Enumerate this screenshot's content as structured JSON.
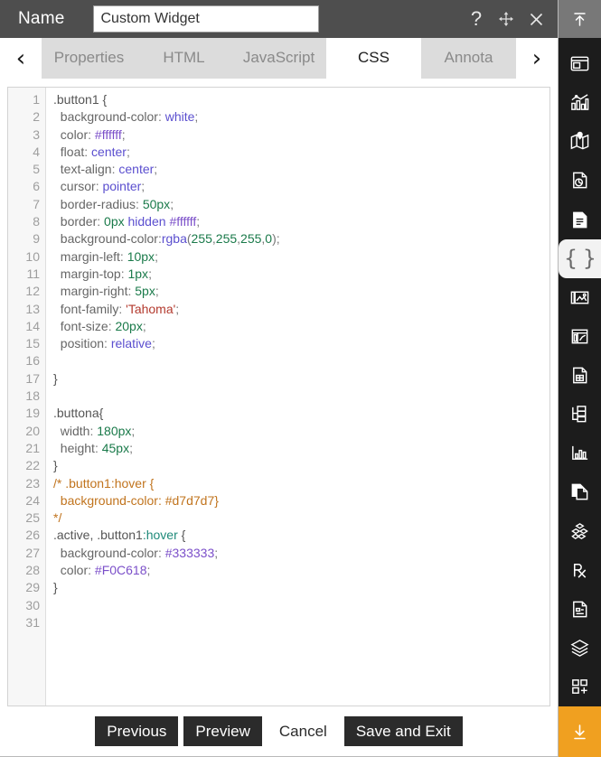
{
  "titlebar": {
    "name_label": "Name",
    "name_value": "Custom Widget",
    "name_placeholder": "Name",
    "help_icon": "question-mark-icon",
    "move_icon": "move-cross-icon",
    "close_icon": "close-x-icon"
  },
  "tabbar": {
    "prev_arrow": "‹",
    "next_arrow": "›",
    "tabs": [
      {
        "label": "Properties",
        "active": false
      },
      {
        "label": "HTML",
        "active": false
      },
      {
        "label": "JavaScript",
        "active": false
      },
      {
        "label": "CSS",
        "active": true
      },
      {
        "label": "Annota",
        "active": false
      }
    ]
  },
  "editor": {
    "language": "css",
    "line_numbers": [
      1,
      2,
      3,
      4,
      5,
      6,
      7,
      8,
      9,
      10,
      11,
      12,
      13,
      14,
      15,
      16,
      17,
      18,
      19,
      20,
      21,
      22,
      23,
      24,
      25,
      26,
      27,
      28,
      29,
      30,
      31
    ],
    "total_lines": 31,
    "lines": [
      ".button1 {",
      "  background-color: white;",
      "  color: #ffffff;",
      "  float: center;",
      "  text-align: center;",
      "  cursor: pointer;",
      "  border-radius: 50px;",
      "  border: 0px hidden #ffffff;",
      "  background-color:rgba(255,255,255,0);",
      "  margin-left: 10px;",
      "  margin-top: 1px;",
      "  margin-right: 5px;",
      "  font-family: 'Tahoma';",
      "  font-size: 20px;",
      "  position: relative;",
      "",
      "}",
      "",
      ".buttona{",
      "  width: 180px;",
      "  height: 45px;",
      "}",
      "/* .button1:hover {",
      "  background-color: #d7d7d7}",
      "*/",
      ".active, .button1:hover {",
      "  background-color: #333333;",
      "  color: #F0C618;",
      "}",
      "",
      ""
    ]
  },
  "footer": {
    "buttons": [
      {
        "label": "Previous",
        "style": "dark"
      },
      {
        "label": "Preview",
        "style": "dark"
      },
      {
        "label": "Cancel",
        "style": "light"
      },
      {
        "label": "Save and Exit",
        "style": "dark"
      }
    ]
  },
  "sidebar": {
    "top_icon": "upload-arrow-icon",
    "bottom_icon": "download-arrow-icon",
    "accent_color": "#f0a020",
    "background_color": "#1c1c1c",
    "items": [
      {
        "icon": "widget-panel-icon",
        "active": false
      },
      {
        "icon": "bar-chart-icon",
        "active": false
      },
      {
        "icon": "map-pin-icon",
        "active": false
      },
      {
        "icon": "pie-report-icon",
        "active": false
      },
      {
        "icon": "document-text-icon",
        "active": false
      },
      {
        "icon": "code-braces-icon",
        "active": true
      },
      {
        "icon": "image-gallery-icon",
        "active": false
      },
      {
        "icon": "dashboard-grid-icon",
        "active": false
      },
      {
        "icon": "spreadsheet-doc-icon",
        "active": false
      },
      {
        "icon": "tree-structure-icon",
        "active": false
      },
      {
        "icon": "analytics-chart-icon",
        "active": false
      },
      {
        "icon": "copy-pages-icon",
        "active": false
      },
      {
        "icon": "cubes-stack-icon",
        "active": false
      },
      {
        "icon": "prescription-rx-icon",
        "active": false
      },
      {
        "icon": "form-document-icon",
        "active": false
      },
      {
        "icon": "layers-icon",
        "active": false
      },
      {
        "icon": "add-widget-icon",
        "active": false
      }
    ]
  },
  "syntax_colors": {
    "selector": "#555555",
    "property": "#666666",
    "keyword": "#5b4fcf",
    "number": "#1a7a4a",
    "hex": "#7b4fc9",
    "string": "#b33a2e",
    "pseudo": "#1f8a7a",
    "comment": "#c1741e"
  }
}
